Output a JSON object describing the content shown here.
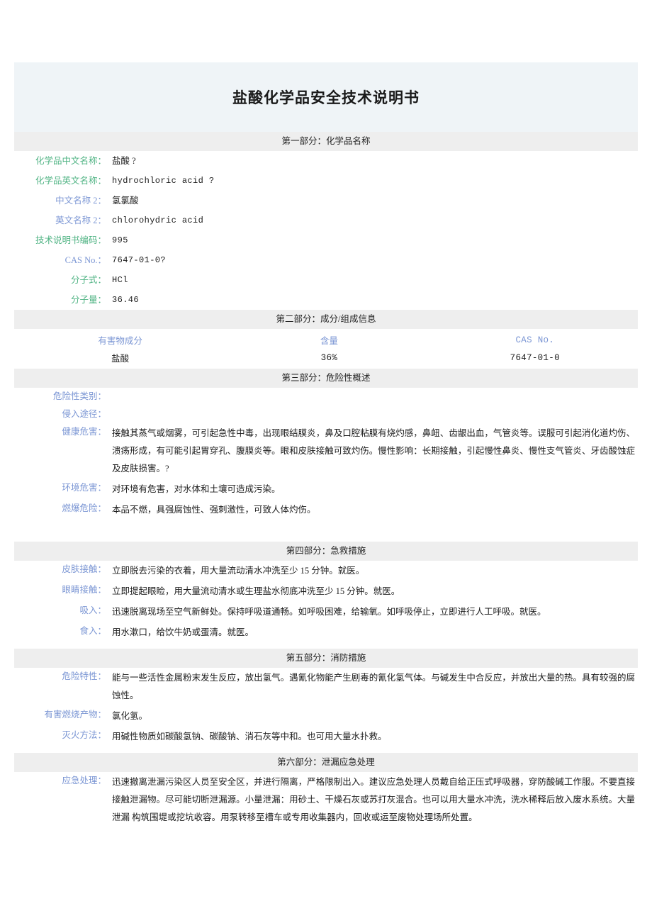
{
  "document": {
    "title": "盐酸化学品安全技术说明书"
  },
  "colors": {
    "title_band": "#eff4f7",
    "section_bar": "#eeeeee",
    "label_green": "#4fb383",
    "label_blue": "#7b96d4",
    "text": "#1b1b1b"
  },
  "section1": {
    "header": "第一部分：化学品名称",
    "fields": [
      {
        "label": "化学品中文名称：",
        "value": "盐酸 ?",
        "color": "green",
        "mono": false
      },
      {
        "label": "化学品英文名称：",
        "value": "hydrochloric acid ?",
        "color": "green",
        "mono": true
      },
      {
        "label": "中文名称 2：",
        "value": "氢氯酸",
        "color": "blue",
        "mono": false
      },
      {
        "label": "英文名称 2：",
        "value": "chlorohydric acid",
        "color": "blue",
        "mono": true
      },
      {
        "label": "技术说明书编码：",
        "value": "995",
        "color": "green",
        "mono": true
      },
      {
        "label": "CAS No.：",
        "value": "7647-01-0?",
        "color": "blue",
        "mono": true
      },
      {
        "label": "分子式：",
        "value": "HCl",
        "color": "green",
        "mono": true
      },
      {
        "label": "分子量：",
        "value": "36.46",
        "color": "green",
        "mono": true
      }
    ]
  },
  "section2": {
    "header": "第二部分：成分/组成信息",
    "columns": [
      "有害物成分",
      "含量",
      "CAS No."
    ],
    "rows": [
      {
        "component": "盐酸",
        "content": "36%",
        "cas": "7647-01-0"
      }
    ]
  },
  "section3": {
    "header": "第三部分：危险性概述",
    "fields": [
      {
        "label": "危险性类别：",
        "value": ""
      },
      {
        "label": "侵入途径：",
        "value": ""
      },
      {
        "label": "健康危害：",
        "value": "接触其蒸气或烟雾，可引起急性中毒，出现眼结膜炎，鼻及口腔粘膜有烧灼感，鼻衄、齿龈出血，气管炎等。误服可引起消化道灼伤、溃疡形成，有可能引起胃穿孔、腹膜炎等。眼和皮肤接触可致灼伤。慢性影响：长期接触，引起慢性鼻炎、慢性支气管炎、牙齿酸蚀症及皮肤损害。?"
      },
      {
        "label": "环境危害：",
        "value": "对环境有危害，对水体和土壤可造成污染。"
      },
      {
        "label": "燃爆危险：",
        "value": "本品不燃，具强腐蚀性、强刺激性，可致人体灼伤。"
      }
    ]
  },
  "section4": {
    "header": "第四部分：急救措施",
    "fields": [
      {
        "label": "皮肤接触：",
        "value": "立即脱去污染的衣着，用大量流动清水冲洗至少 15 分钟。就医。"
      },
      {
        "label": "眼睛接触：",
        "value": "立即提起眼睑，用大量流动清水或生理盐水彻底冲洗至少 15 分钟。就医。"
      },
      {
        "label": "吸入：",
        "value": "迅速脱离现场至空气新鲜处。保持呼吸道通畅。如呼吸困难，给输氧。如呼吸停止，立即进行人工呼吸。就医。"
      },
      {
        "label": "食入：",
        "value": "用水漱口，给饮牛奶或蛋清。就医。"
      }
    ]
  },
  "section5": {
    "header": "第五部分：消防措施",
    "fields": [
      {
        "label": "危险特性：",
        "value": "能与一些活性金属粉末发生反应，放出氢气。遇氰化物能产生剧毒的氰化氢气体。与碱发生中合反应，并放出大量的热。具有较强的腐蚀性。"
      },
      {
        "label": "有害燃烧产物：",
        "value": "氯化氢。"
      },
      {
        "label": "灭火方法：",
        "value": "用碱性物质如碳酸氢钠、碳酸钠、消石灰等中和。也可用大量水扑救。"
      }
    ]
  },
  "section6": {
    "header": "第六部分：泄漏应急处理",
    "fields": [
      {
        "label": "应急处理：",
        "value": "迅速撤离泄漏污染区人员至安全区，并进行隔离，严格限制出入。建议应急处理人员戴自给正压式呼吸器，穿防酸碱工作服。不要直接接触泄漏物。尽可能切断泄漏源。小量泄漏：用砂土、干燥石灰或苏打灰混合。也可以用大量水冲洗，洗水稀释后放入废水系统。大量泄漏 构筑围堤或挖坑收容。用泵转移至槽车或专用收集器内，回收或运至废物处理场所处置。"
      }
    ]
  }
}
